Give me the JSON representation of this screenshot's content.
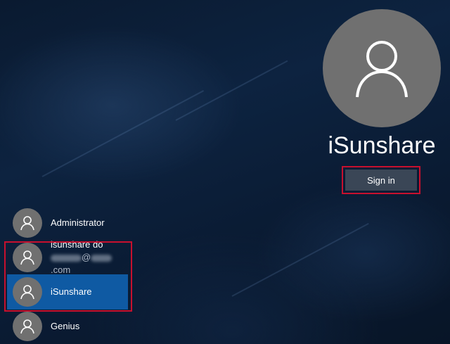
{
  "current_user": {
    "name": "iSunshare",
    "sign_in_label": "Sign in",
    "avatar_icon": "user-icon"
  },
  "users": [
    {
      "name": "Administrator",
      "icon": "user-icon"
    },
    {
      "name": "isunshare do",
      "email_suffix": "@",
      "email_domain": ".com",
      "email_obscured": true,
      "icon": "user-icon"
    },
    {
      "name": "iSunshare",
      "icon": "user-icon",
      "selected": true
    },
    {
      "name": "Genius",
      "icon": "user-icon"
    }
  ],
  "colors": {
    "selected": "#0f5aa3",
    "highlight_border": "#c8102e",
    "avatar": "#707070",
    "button": "#3a4656"
  }
}
